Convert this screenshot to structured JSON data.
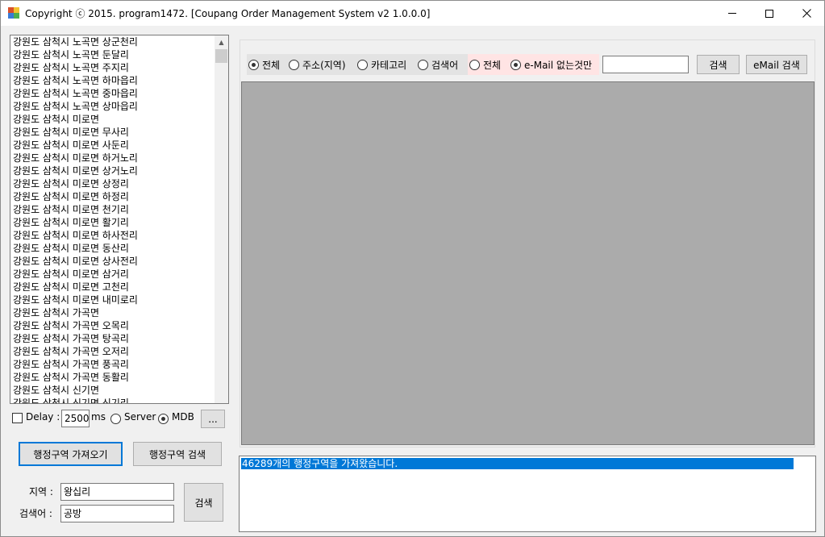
{
  "window": {
    "title": "Copyright ⓒ 2015. program1472. [Coupang Order Management System v2 1.0.0.0]",
    "min_glyph": "",
    "close_glyph": "✕"
  },
  "region_list": {
    "items": [
      "강원도 삼척시 노곡면 상군천리",
      "강원도 삼척시 노곡면 둔달리",
      "강원도 삼척시 노곡면 주지리",
      "강원도 삼척시 노곡면 하마읍리",
      "강원도 삼척시 노곡면 중마읍리",
      "강원도 삼척시 노곡면 상마읍리",
      "강원도 삼척시 미로면",
      "강원도 삼척시 미로면 무사리",
      "강원도 삼척시 미로면 사둔리",
      "강원도 삼척시 미로면 하거노리",
      "강원도 삼척시 미로면 상거노리",
      "강원도 삼척시 미로면 상정리",
      "강원도 삼척시 미로면 하정리",
      "강원도 삼척시 미로면 천기리",
      "강원도 삼척시 미로면 활기리",
      "강원도 삼척시 미로면 하사전리",
      "강원도 삼척시 미로면 동산리",
      "강원도 삼척시 미로면 상사전리",
      "강원도 삼척시 미로면 삼거리",
      "강원도 삼척시 미로면 고천리",
      "강원도 삼척시 미로면 내미로리",
      "강원도 삼척시 가곡면",
      "강원도 삼척시 가곡면 오목리",
      "강원도 삼척시 가곡면 탕곡리",
      "강원도 삼척시 가곡면 오저리",
      "강원도 삼척시 가곡면 풍곡리",
      "강원도 삼척시 가곡면 동활리",
      "강원도 삼척시 신기면",
      "강원도 삼척시 신기면 신기리"
    ],
    "scroll_up_glyph": "▲"
  },
  "delay": {
    "label": "Delay :",
    "value": "2500",
    "unit": "ms",
    "server_label": "Server",
    "mdb_label": "MDB",
    "more_label": "..."
  },
  "buttons": {
    "fetch_regions": "행정구역 가져오기",
    "search_regions": "행정구역 검색",
    "search": "검색",
    "top_search": "검색",
    "email_search": "eMail 검색"
  },
  "fields": {
    "region_label": "지역 :",
    "region_value": "왕십리",
    "keyword_label": "검색어 :",
    "keyword_value": "공방"
  },
  "filters": {
    "search_type": [
      "전체",
      "주소(지역)",
      "카테고리",
      "검색어"
    ],
    "email_type": [
      "전체",
      "e-Mail 없는것만"
    ],
    "search_input_value": ""
  },
  "log": {
    "lines": [
      "46289개의 행정구역을 가져왔습니다."
    ]
  }
}
